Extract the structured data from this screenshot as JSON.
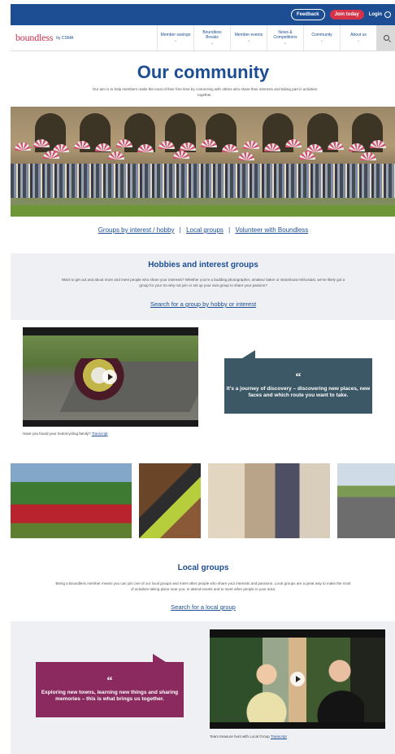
{
  "topbar": {
    "feedback": "Feedback",
    "join_today": "Join today",
    "login": "Login",
    "colors": {
      "bar": "#1d4e94",
      "join": "#d63348"
    }
  },
  "navbar": {
    "brand": "boundless",
    "brand_sub": "by CSMA",
    "items": [
      {
        "label": "Member savings"
      },
      {
        "label": "Boundless Breaks"
      },
      {
        "label": "Member events"
      },
      {
        "label": "News & Competitions"
      },
      {
        "label": "Community"
      },
      {
        "label": "About us"
      }
    ],
    "search_icon": "search-icon"
  },
  "page": {
    "title": "Our community",
    "intro": "Our aim is to help members make the most of their free time by connecting with others who share their interests and taking part in activities together."
  },
  "quick_links": {
    "hobby": "Groups by interest / hobby",
    "local": "Local groups",
    "volunteer": "Volunteer with Boundless",
    "separator": "|"
  },
  "hobbies": {
    "title": "Hobbies and interest groups",
    "body": "Want to get out and about more and meet people who share your interests? Whether you're a budding photographer, amateur baker or steamboat enthusiast, we've likely got a group for you! So why not join or set up your own group to share your passion?",
    "link": "Search for a group by hobby or interest",
    "video_caption": "Have you found your motorcycling family?",
    "transcript": "Transcript",
    "quote": "It's a journey of discovery – discovering new places, new faces and which route you want to take.",
    "quote_mark": "“"
  },
  "local": {
    "title": "Local groups",
    "body": "Being a Boundless member means you can join one of our local groups and meet other people who share your interests and passions. Local groups are a great way to make the most of activities taking place near you, to attend events and to meet other people in your area.",
    "link": "Search for a local group",
    "quote": "Exploring new towns, learning new things and sharing memories – this is what brings us together.",
    "quote_mark": "“",
    "video_caption": "Team treasure hunt with Local Group",
    "transcript": "Transcript"
  }
}
